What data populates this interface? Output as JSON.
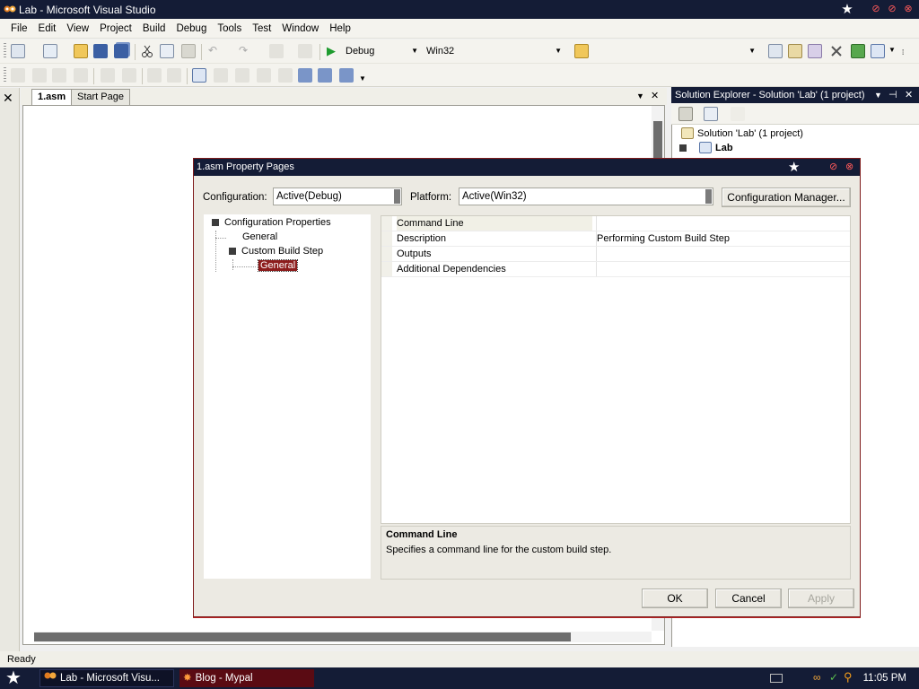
{
  "window": {
    "title": "Lab - Microsoft Visual Studio"
  },
  "menu": {
    "items": [
      "File",
      "Edit",
      "View",
      "Project",
      "Build",
      "Debug",
      "Tools",
      "Test",
      "Window",
      "Help"
    ]
  },
  "toolbar": {
    "config_combo": "Debug",
    "platform_combo": "Win32"
  },
  "document": {
    "tabs": [
      {
        "label": "1.asm",
        "active": true
      },
      {
        "label": "Start Page",
        "active": false
      }
    ]
  },
  "solution_explorer": {
    "title": "Solution Explorer - Solution 'Lab' (1 project)",
    "solution_label": "Solution 'Lab' (1 project)",
    "project_label": "Lab"
  },
  "dialog": {
    "title": "1.asm Property Pages",
    "configuration_label": "Configuration:",
    "configuration_value": "Active(Debug)",
    "platform_label": "Platform:",
    "platform_value": "Active(Win32)",
    "config_manager_button": "Configuration Manager...",
    "tree": [
      {
        "label": "Configuration Properties",
        "level": 0,
        "expander": true
      },
      {
        "label": "General",
        "level": 1,
        "expander": false
      },
      {
        "label": "Custom Build Step",
        "level": 1,
        "expander": true
      },
      {
        "label": "General",
        "level": 2,
        "expander": false,
        "selected": true
      }
    ],
    "properties": [
      {
        "name": "Command Line",
        "value": "",
        "highlighted": true
      },
      {
        "name": "Description",
        "value": "Performing Custom Build Step",
        "highlighted": false
      },
      {
        "name": "Outputs",
        "value": "",
        "highlighted": false
      },
      {
        "name": "Additional Dependencies",
        "value": "",
        "highlighted": false
      }
    ],
    "description_title": "Command Line",
    "description_text": "Specifies a command line for the custom build step.",
    "ok_button": "OK",
    "cancel_button": "Cancel",
    "apply_button": "Apply"
  },
  "status": {
    "text": "Ready"
  },
  "taskbar": {
    "items": [
      {
        "label": "Lab - Microsoft Visu...",
        "active": true
      },
      {
        "label": "Blog - Mypal",
        "active": false
      }
    ],
    "clock": "11:05 PM"
  },
  "colors": {
    "title_bar": "#141c36",
    "selection": "#8c1c1c",
    "dialog_border": "#7f1b1b"
  }
}
